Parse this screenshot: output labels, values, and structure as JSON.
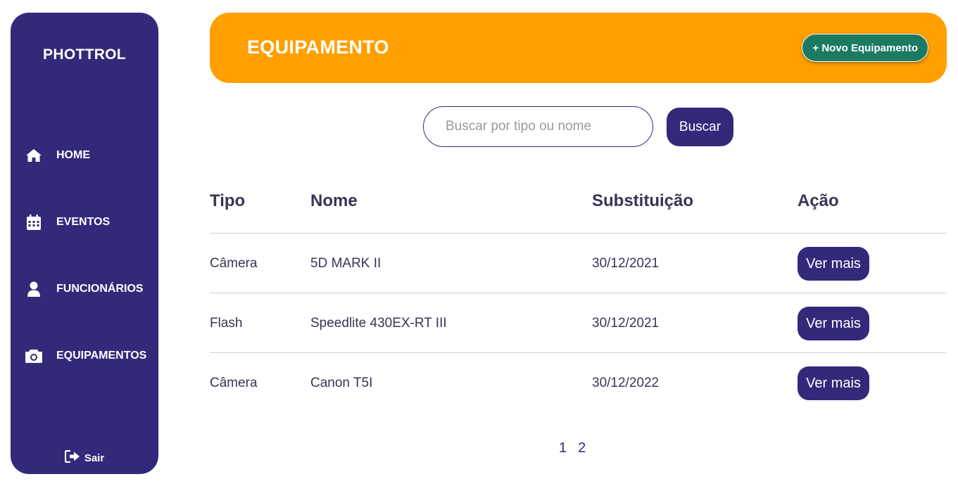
{
  "sidebar": {
    "brand": "PHOTTROL",
    "items": [
      {
        "label": "HOME",
        "icon": "home-icon"
      },
      {
        "label": "EVENTOS",
        "icon": "calendar-icon"
      },
      {
        "label": "FUNCIONÁRIOS",
        "icon": "user-icon"
      },
      {
        "label": "EQUIPAMENTOS",
        "icon": "camera-icon"
      }
    ],
    "logout": {
      "label": "Sair",
      "icon": "sign-out-icon"
    }
  },
  "header": {
    "title": "EQUIPAMENTO",
    "new_button": "+ Novo Equipamento"
  },
  "search": {
    "placeholder": "Buscar por tipo ou nome",
    "value": "",
    "button": "Buscar"
  },
  "table": {
    "headers": [
      "Tipo",
      "Nome",
      "Substituição",
      "Ação"
    ],
    "rows": [
      {
        "tipo": "Câmera",
        "nome": "5D MARK II",
        "substituicao": "30/12/2021",
        "acao": "Ver mais"
      },
      {
        "tipo": "Flash",
        "nome": "Speedlite 430EX-RT III",
        "substituicao": "30/12/2021",
        "acao": "Ver mais"
      },
      {
        "tipo": "Câmera",
        "nome": "Canon T5I",
        "substituicao": "30/12/2022",
        "acao": "Ver mais"
      }
    ]
  },
  "pagination": {
    "pages": [
      "1",
      "2"
    ]
  },
  "colors": {
    "primary": "#33297a",
    "header": "#ffa000",
    "accent_button": "#1c7a63",
    "text": "#3a3356"
  }
}
